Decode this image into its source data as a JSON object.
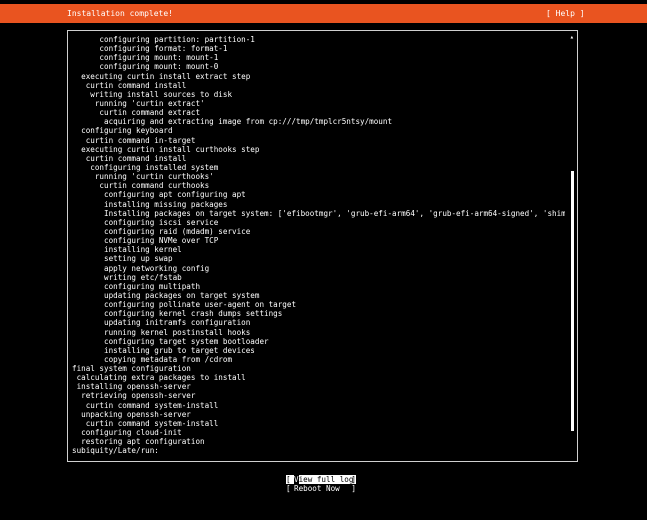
{
  "header": {
    "title": "Installation complete!",
    "help_label": "[ Help ]",
    "background_color": "#e95420"
  },
  "log": {
    "lines": [
      "      configuring partition: partition-1",
      "      configuring format: format-1",
      "      configuring mount: mount-1",
      "      configuring mount: mount-0",
      "  executing curtin install extract step",
      "   curtin command install",
      "    writing install sources to disk",
      "     running 'curtin extract'",
      "      curtin command extract",
      "       acquiring and extracting image from cp:///tmp/tmplcr5ntsy/mount",
      "  configuring keyboard",
      "   curtin command in-target",
      "  executing curtin install curthooks step",
      "   curtin command install",
      "    configuring installed system",
      "     running 'curtin curthooks'",
      "      curtin command curthooks",
      "       configuring apt configuring apt",
      "       installing missing packages",
      "       Installing packages on target system: ['efibootmgr', 'grub-efi-arm64', 'grub-efi-arm64-signed', 'shim-signed']",
      "       configuring iscsi service",
      "       configuring raid (mdadm) service",
      "       configuring NVMe over TCP",
      "       installing kernel",
      "       setting up swap",
      "       apply networking config",
      "       writing etc/fstab",
      "       configuring multipath",
      "       updating packages on target system",
      "       configuring pollinate user-agent on target",
      "       configuring kernel crash dumps settings",
      "       updating initramfs configuration",
      "       running kernel postinstall hooks",
      "       configuring target system bootloader",
      "       installing grub to target devices",
      "       copying metadata from /cdrom",
      "final system configuration",
      " calculating extra packages to install",
      " installing openssh-server",
      "  retrieving openssh-server",
      "   curtin command system-install",
      "  unpacking openssh-server",
      "   curtin command system-install",
      "  configuring cloud-init",
      "  restoring apt configuration",
      "subiquity/Late/run:"
    ],
    "scroll_up_indicator": "▴",
    "scroll_position": 0.84
  },
  "buttons": {
    "view_full_log": {
      "open": "[",
      "cursor_char": "V",
      "rest": "iew full log",
      "close": "]"
    },
    "reboot_now": {
      "open": "[",
      "label": "Reboot Now",
      "close": "]"
    }
  }
}
